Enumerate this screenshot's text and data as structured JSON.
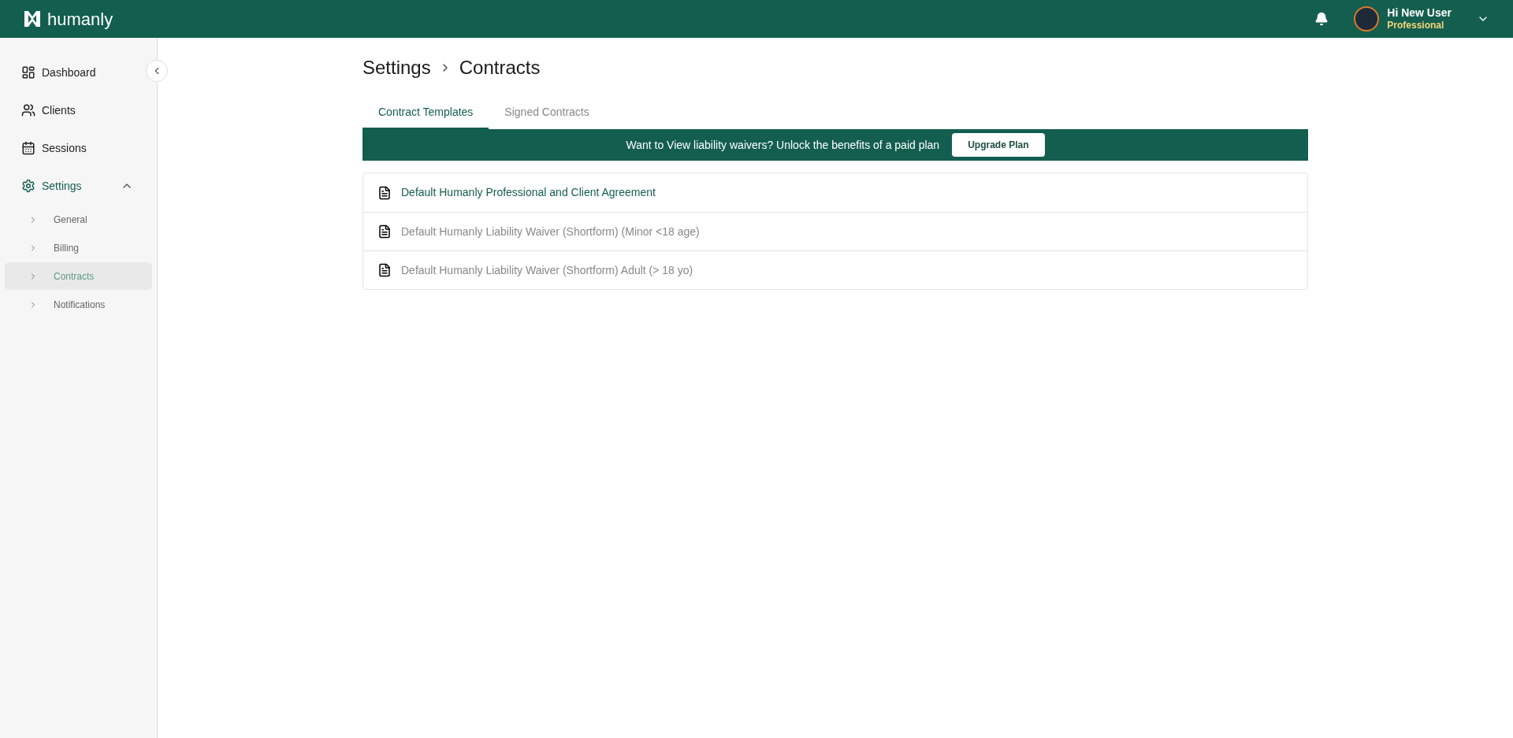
{
  "header": {
    "logo": "humanly",
    "user_name": "Hi New User",
    "user_plan": "Professional"
  },
  "sidebar": {
    "items": [
      {
        "label": "Dashboard",
        "kind": "dashboard",
        "selected": false
      },
      {
        "label": "Clients",
        "kind": "clients",
        "selected": false
      },
      {
        "label": "Sessions",
        "kind": "sessions",
        "selected": false
      },
      {
        "label": "Settings",
        "kind": "settings",
        "selected": true,
        "expanded": true,
        "children": [
          {
            "label": "General",
            "selected": false
          },
          {
            "label": "Billing",
            "selected": false
          },
          {
            "label": "Contracts",
            "selected": true
          },
          {
            "label": "Notifications",
            "selected": false
          }
        ]
      }
    ]
  },
  "breadcrumb": [
    "Settings",
    "Contracts"
  ],
  "tabs": [
    {
      "label": "Contract Templates",
      "selected": true
    },
    {
      "label": "Signed Contracts",
      "selected": false
    }
  ],
  "banner": {
    "text": "Want to View liability waivers? Unlock the benefits of a paid plan",
    "button": "Upgrade Plan"
  },
  "templates": [
    {
      "title": "Default Humanly Professional and Client Agreement",
      "locked": false
    },
    {
      "title": "Default Humanly Liability Waiver (Shortform) (Minor <18 age)",
      "locked": true
    },
    {
      "title": "Default Humanly Liability Waiver (Shortform) Adult (> 18 yo)",
      "locked": true
    }
  ]
}
